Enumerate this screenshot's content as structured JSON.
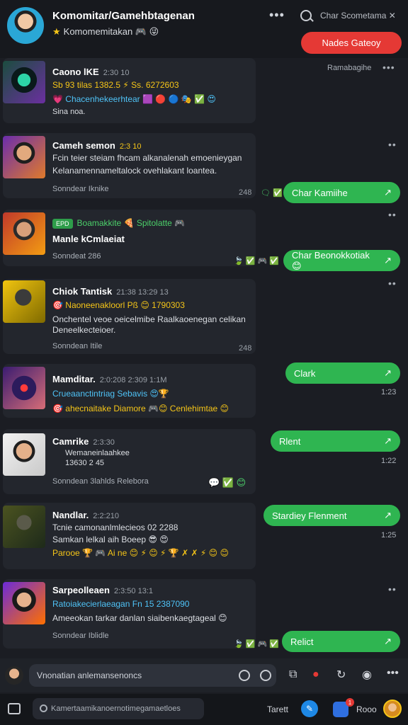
{
  "header": {
    "title": "Komomitar/Gamehbtagenan",
    "subtitle": "Komomemitakan 🎮 😜",
    "search_label": "Char Scometama ✕",
    "primary_button": "Nades Gateoy"
  },
  "right_panel": {
    "top_label": "Ramabagihe"
  },
  "cards": [
    {
      "title": "Caono lKE",
      "time": "2:30 10",
      "lines": [
        {
          "text": "Sb 93 tilas 1382.5 ⚡ Ss. 6272603",
          "style": "yellow"
        },
        {
          "text": "💗 Chacenhekeerhtear 🟪 🔴 🔵 🎭 ✅ 😍",
          "style": "accent"
        },
        {
          "text": "Sina noa.",
          "style": "plain"
        }
      ],
      "meta": ""
    },
    {
      "title": "Cameh semon",
      "time": "2:3 10",
      "lines": [
        {
          "text": "Fcin teier steiam fhcam alkanalenah emoenieygan",
          "style": "plain"
        },
        {
          "text": "Kelanamennameltalock ovehlakant loantea.",
          "style": "plain"
        }
      ],
      "meta": "Sonndear   Iknike",
      "reactions": "🗨 ✅",
      "count": "248",
      "reply": "Char Kamiihe"
    },
    {
      "title": "Manle kCmlaeiat",
      "time": "",
      "tag": "EPD",
      "lines": [],
      "badge_line": "Boamakkite 🍕 Spitolatte 🎮",
      "meta": "Sonndeat   286",
      "reactions": "🍃 ✅ 🎮 ✅",
      "reply": "Char Beonokkotiak 😊"
    },
    {
      "title": "Chiok Tantisk",
      "time": "21:38 13:29 13",
      "lines": [
        {
          "text": "🎯 Naoneenakloorl  Pß 😊 1790303",
          "style": "yellow"
        },
        {
          "text": "Onchentel veoe oeicelmibe Raalkaoenegan celikan",
          "style": "plain"
        },
        {
          "text": "Deneelkecteioer.",
          "style": "plain"
        }
      ],
      "meta": "Sonndean   Itile",
      "count": "248"
    },
    {
      "title": "Mamditar.",
      "time": "2:0:208 2:309 1:1M",
      "lines": [
        {
          "text": "Crueaanctintriag Sebavis 😍🏆",
          "style": "accent"
        },
        {
          "text": "🎯 ahecnaitake Diamore 🎮😊 Cenlehimtae 😊",
          "style": "yellow"
        }
      ],
      "meta": "",
      "reply": "Clark",
      "reply_time": "1:23"
    },
    {
      "title": "Camrike",
      "time": "2:3:30",
      "lines": [
        {
          "text": "Wemaneinlaahkee",
          "style": "plain"
        },
        {
          "text": "13630 2 45",
          "style": "plain"
        }
      ],
      "meta": "Sonndean   3lahlds        Relebora",
      "reactions": "💬 ✅ 😊",
      "reply": "Rlent",
      "reply_time": "1:22"
    },
    {
      "title": "Nandlar.",
      "time": "2:2:210",
      "lines": [
        {
          "text": "Tcnie camonanlmlecieos 02 2288",
          "style": "plain"
        },
        {
          "text": "Samkan lelkal aih Boeep 😎 😍",
          "style": "plain"
        },
        {
          "text": "Parooe 🏆 🎮 Ai ne 😊 ⚡ 😊 ⚡ 🏆 ✗ ✗ ⚡ 😊 😊",
          "style": "yellow"
        }
      ],
      "meta": "",
      "reply": "Stardiey     Flenment",
      "reply_time": "1:25"
    },
    {
      "title": "Sarpeolleaen",
      "time": "2:3:50 13:1",
      "lines": [
        {
          "text": "Ratoiakecierlaeagan Fn 15 2387090",
          "style": "accent"
        },
        {
          "text": "Ameeokan tarkar danlan siaibenkaegtageal 😊",
          "style": "plain"
        }
      ],
      "meta": "Sonndear   Iblidle",
      "reactions": "🍃 ✅ 🎮 ✅",
      "reply": "Relict"
    }
  ],
  "composer": {
    "placeholder": "Vnonatian anlemansenoncs"
  },
  "bottom_bar": {
    "search_placeholder": "Kamertaamikanoernotimegamaetloes",
    "tab_label": "Tarett",
    "notif_badge": "1",
    "right_label": "Rooo"
  },
  "colors": {
    "accent_green": "#2fb551",
    "accent_red": "#e53935",
    "background": "#1b1d23",
    "card": "#23262d"
  }
}
